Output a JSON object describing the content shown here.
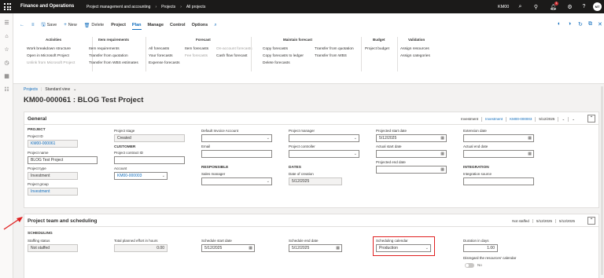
{
  "topbar": {
    "app_name": "Finance and Operations",
    "breadcrumbs": [
      "Project management and accounting",
      "Projects",
      "All projects"
    ],
    "company": "KM00",
    "notification_count": "1",
    "user_initials": "MT"
  },
  "toolbar": {
    "save": "Save",
    "new": "New",
    "delete": "Delete",
    "tabs": [
      "Project",
      "Plan",
      "Manage",
      "Control",
      "Options"
    ],
    "active_tab": "Plan"
  },
  "action_groups": [
    {
      "header": "Activities",
      "items": [
        "Work breakdown structure",
        "Open in Microsoft Project",
        "Unlink from Microsoft Project"
      ]
    },
    {
      "header": "Item requirements",
      "items": [
        "Item requirements",
        "Transfer from quotation",
        "Transfer from WBS estimates"
      ]
    },
    {
      "header": "Forecast",
      "col1": [
        "All forecasts",
        "Your forecasts",
        "Expense forecasts"
      ],
      "col2": [
        "Item forecasts",
        "Fee forecasts"
      ],
      "col3": [
        "On-account forecasts",
        "Cash flow forecast"
      ]
    },
    {
      "header": "Maintain forecast",
      "col1": [
        "Copy forecasts",
        "Copy forecasts to ledger",
        "Delete forecasts"
      ],
      "col2": [
        "Transfer from quotation",
        "Transfer from WBS"
      ]
    },
    {
      "header": "Budget",
      "items": [
        "Project budget"
      ]
    },
    {
      "header": "Validation",
      "items": [
        "Assign resources",
        "Assign categories"
      ]
    }
  ],
  "page": {
    "breadcrumb_link": "Projects",
    "view": "Standard view",
    "title": "KM00-000061 : BLOG Test Project"
  },
  "general": {
    "title": "General",
    "summary": [
      "Investment",
      "Investment",
      "KM00-000003",
      "5/12/2025"
    ],
    "project_section": "PROJECT",
    "project_id_label": "Project ID",
    "project_id": "KM00-000061",
    "project_name_label": "Project name",
    "project_name": "BLOG Test Project",
    "project_type_label": "Project type",
    "project_type": "Investment",
    "project_group_label": "Project group",
    "project_group": "Investment",
    "project_stage_label": "Project stage",
    "project_stage": "Created",
    "customer_section": "CUSTOMER",
    "project_contract_label": "Project contract ID",
    "project_contract": "",
    "account_label": "Account",
    "account": "KM00-000003",
    "default_invoice_label": "Default Invoice Account",
    "default_invoice": "",
    "email_label": "Email",
    "email": "",
    "responsible_section": "RESPONSIBLE",
    "sales_manager_label": "Sales manager",
    "sales_manager": "",
    "project_manager_label": "Project manager",
    "project_manager": "",
    "project_controller_label": "Project controller",
    "project_controller": "",
    "dates_section": "DATES",
    "date_of_creation_label": "Date of creation",
    "date_of_creation": "5/12/2025",
    "projected_start_label": "Projected start date",
    "projected_start": "5/12/2025",
    "actual_start_label": "Actual start date",
    "actual_start": "",
    "projected_end_label": "Projected end date",
    "projected_end": "",
    "extension_label": "Extension date",
    "extension": "",
    "actual_end_label": "Actual end date",
    "actual_end": "",
    "integration_section": "INTEGRATION",
    "integration_source_label": "Integration source",
    "integration_source": ""
  },
  "scheduling": {
    "title": "Project team and scheduling",
    "summary": [
      "Not staffed",
      "5/12/2025",
      "5/12/2025"
    ],
    "section": "SCHEDULING",
    "staffing_status_label": "Staffing status",
    "staffing_status": "Not staffed",
    "total_effort_label": "Total planned effort in hours",
    "total_effort": "0.00",
    "schedule_start_label": "Schedule start date",
    "schedule_start": "5/12/2025",
    "schedule_end_label": "Schedule end date",
    "schedule_end": "5/12/2025",
    "calendar_label": "Scheduling calendar",
    "calendar": "Production",
    "duration_label": "Duration in days",
    "duration": "1.00",
    "disregard_label": "Disregard the resources' calendar",
    "disregard_value": "No"
  },
  "colors": {
    "topbar": "#1b1a19",
    "accent": "#0f6cbd",
    "highlight": "#e02020"
  }
}
